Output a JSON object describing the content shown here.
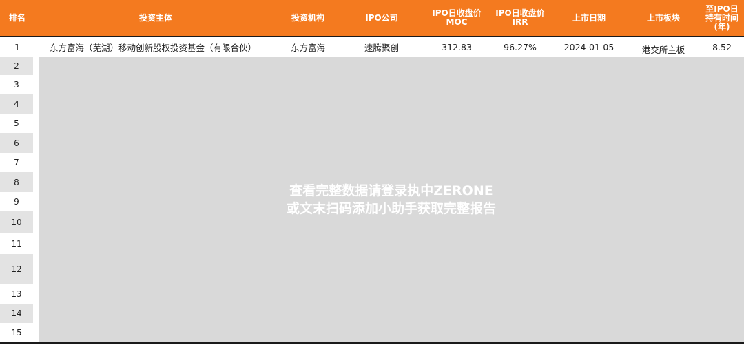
{
  "header": {
    "rank": "排名",
    "investor": "投资主体",
    "institution": "投资机构",
    "ipo_company": "IPO公司",
    "moc": "IPO日收盘价\nMOC",
    "irr": "IPO日收盘价\nIRR",
    "listing_date": "上市日期",
    "board": "上市板块",
    "holding": "至IPO日\n持有时间\n(年)"
  },
  "rows": [
    {
      "rank": "1",
      "investor": "东方富海（芜湖）移动创新股权投资基金（有限合伙）",
      "institution": "东方富海",
      "ipo_company": "速腾聚创",
      "moc": "312.83",
      "irr": "96.27%",
      "listing_date": "2024-01-05",
      "board": "港交所主板",
      "holding": "8.52"
    }
  ],
  "ranks": [
    "2",
    "3",
    "4",
    "5",
    "6",
    "7",
    "8",
    "9",
    "10",
    "11",
    "12",
    "13",
    "14",
    "15"
  ],
  "watermark": {
    "line1": "查看完整数据请登录执中ZERONE",
    "line2": "或文末扫码添加小助手获取完整报告"
  }
}
